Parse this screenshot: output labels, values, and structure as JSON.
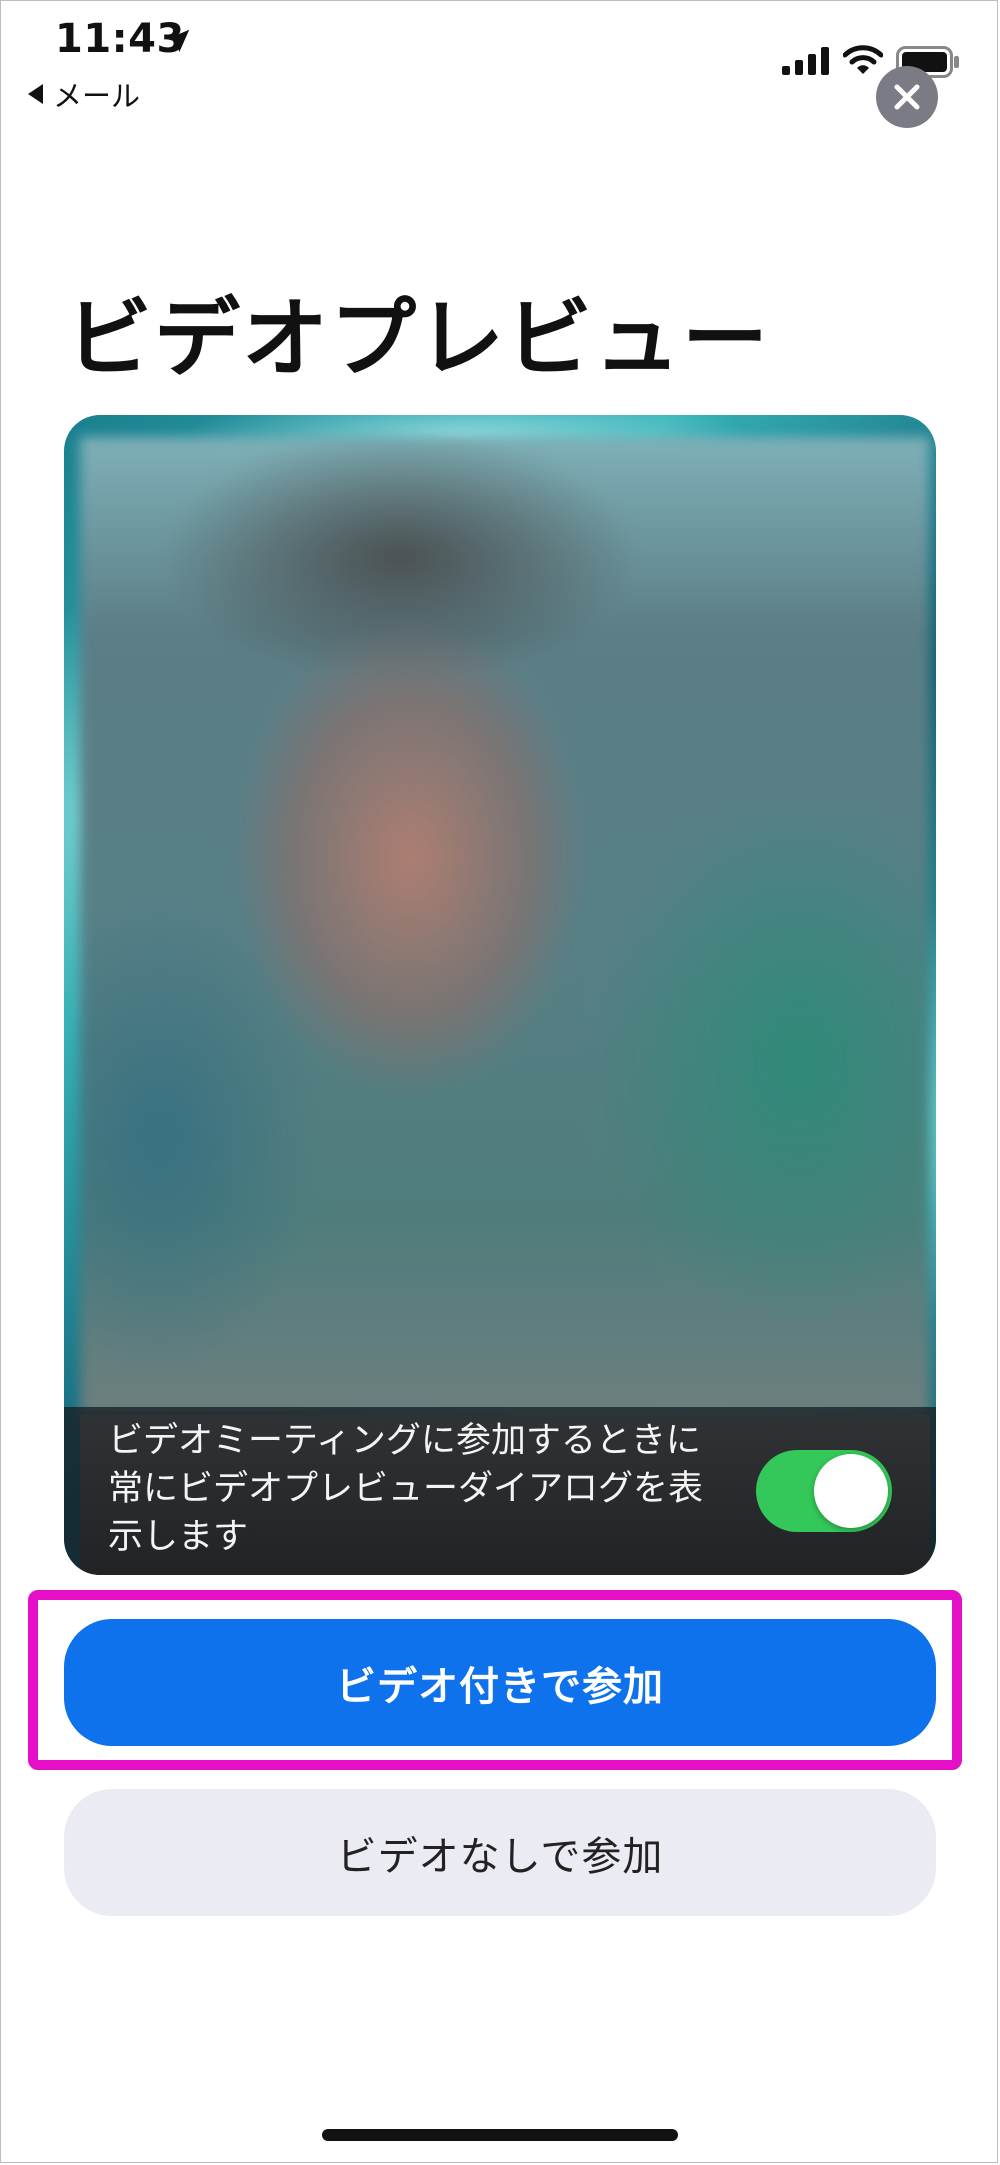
{
  "status_bar": {
    "time": "11:43",
    "back_label": "メール",
    "icons": [
      "location-arrow-icon",
      "signal-icon",
      "wifi-icon",
      "battery-icon"
    ]
  },
  "close_icon": "close-icon",
  "title": "ビデオプレビュー",
  "preview": {
    "setting_text_line1": "ビデオミーティングに参加するときに",
    "setting_text_line2": "常にビデオプレビューダイアログを表",
    "setting_text_line3": "示します",
    "toggle_on": true,
    "toggle_color": "#34c759"
  },
  "buttons": {
    "join_with_video": "ビデオ付きで参加",
    "join_without_video": "ビデオなしで参加"
  },
  "colors": {
    "primary": "#0e72ed",
    "highlight": "#e50fc8",
    "secondary_button": "#ebebf3"
  }
}
